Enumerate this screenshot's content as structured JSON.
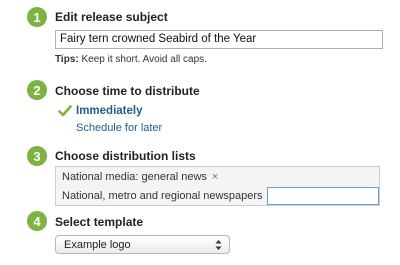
{
  "steps": [
    {
      "number": "1",
      "title": "Edit release subject",
      "subject_value": "Fairy tern crowned Seabird of the Year",
      "tips_label": "Tips:",
      "tips_text": " Keep it short. Avoid all caps."
    },
    {
      "number": "2",
      "title": "Choose time to distribute",
      "selected_option": "Immediately",
      "other_option": "Schedule for later"
    },
    {
      "number": "3",
      "title": "Choose distribution lists",
      "lists": [
        "National media: general news",
        "National, metro and regional newspapers"
      ],
      "remove_glyph": "×"
    },
    {
      "number": "4",
      "title": "Select template",
      "template_value": "Example logo"
    }
  ],
  "colors": {
    "step_badge": "#7cb342",
    "link": "#1f5f8b",
    "check": "#7cb342"
  },
  "icons": {
    "selected": "check-icon",
    "remove": "close-icon",
    "select": "select-arrows-icon"
  }
}
